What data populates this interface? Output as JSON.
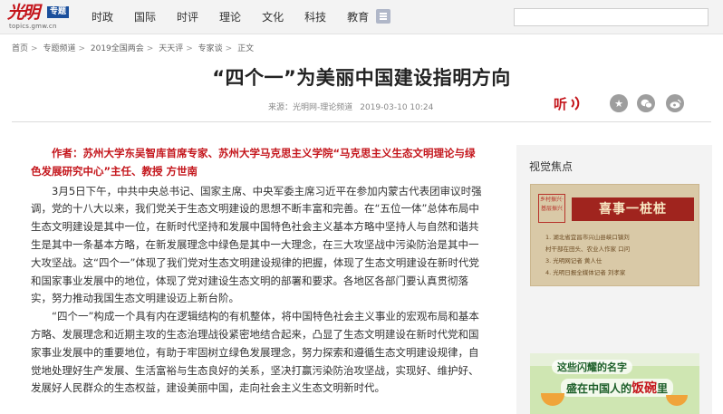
{
  "logo": {
    "brand": "光明",
    "tag": "专题",
    "url": "topics.gmw.cn"
  },
  "nav": [
    "时政",
    "国际",
    "时评",
    "理论",
    "文化",
    "科技",
    "教育"
  ],
  "breadcrumb": [
    "首页",
    "专题频道",
    "2019全国两会",
    "天天评",
    "专家谈",
    "正文"
  ],
  "breadcrumb_sep": ">",
  "article": {
    "title": "“四个一”为美丽中国建设指明方向",
    "source": "来源：光明网-理论频道",
    "date": "2019-03-10 10:24",
    "author": "作者：苏州大学东吴智库首席专家、苏州大学马克思主义学院“马克思主义生态文明理论与绿色发展研究中心”主任、教授 方世南",
    "paragraphs": [
      "3月5日下午，中共中央总书记、国家主席、中央军委主席习近平在参加内蒙古代表团审议时强调，党的十八大以来，我们党关于生态文明建设的思想不断丰富和完善。在“五位一体”总体布局中生态文明建设是其中一位，在新时代坚持和发展中国特色社会主义基本方略中坚持人与自然和谐共生是其中一条基本方略，在新发展理念中绿色是其中一大理念，在三大攻坚战中污染防治是其中一大攻坚战。这“四个一”体现了我们党对生态文明建设规律的把握，体现了生态文明建设在新时代党和国家事业发展中的地位，体现了党对建设生态文明的部署和要求。各地区各部门要认真贯彻落实，努力推动我国生态文明建设迈上新台阶。",
      "“四个一”构成一个具有内在逻辑结构的有机整体，将中国特色社会主义事业的宏观布局和基本方略、发展理念和近期主攻的生态治理战役紧密地结合起来，凸显了生态文明建设在新时代党和国家事业发展中的重要地位，有助于牢固树立绿色发展理念，努力探索和遵循生态文明建设规律，自觉地处理好生产发展、生活富裕与生态良好的关系，坚决打赢污染防治攻坚战，实现好、维护好、发展好人民群众的生态权益，建设美丽中国，走向社会主义生态文明新时代。"
    ]
  },
  "sidebar": {
    "title": "视觉焦点",
    "card1": {
      "tag": "乡村振兴·基层振兴",
      "headline": "喜事一桩桩",
      "lines": [
        "1. 湖北省宜昌市兴山县峡口镇刘",
        "村干部在田头、农业人作家 口问",
        "3. 光明网记者 黄人仕",
        "4. 光明日报全媒体记者 刘孝家"
      ]
    },
    "card2": {
      "line1": "这些闪耀的名字",
      "line2_pre": "盛在中国人的",
      "line2_hl": "饭碗",
      "line2_post": "里"
    }
  },
  "colors": {
    "accent": "#c4161c",
    "logo_tag": "#1a4f9c",
    "share": "#9e9e9e"
  },
  "icons": {
    "menu": "menu-icon",
    "listen": "listen-icon",
    "star": "star-icon",
    "wechat": "wechat-icon",
    "weibo": "weibo-icon"
  }
}
